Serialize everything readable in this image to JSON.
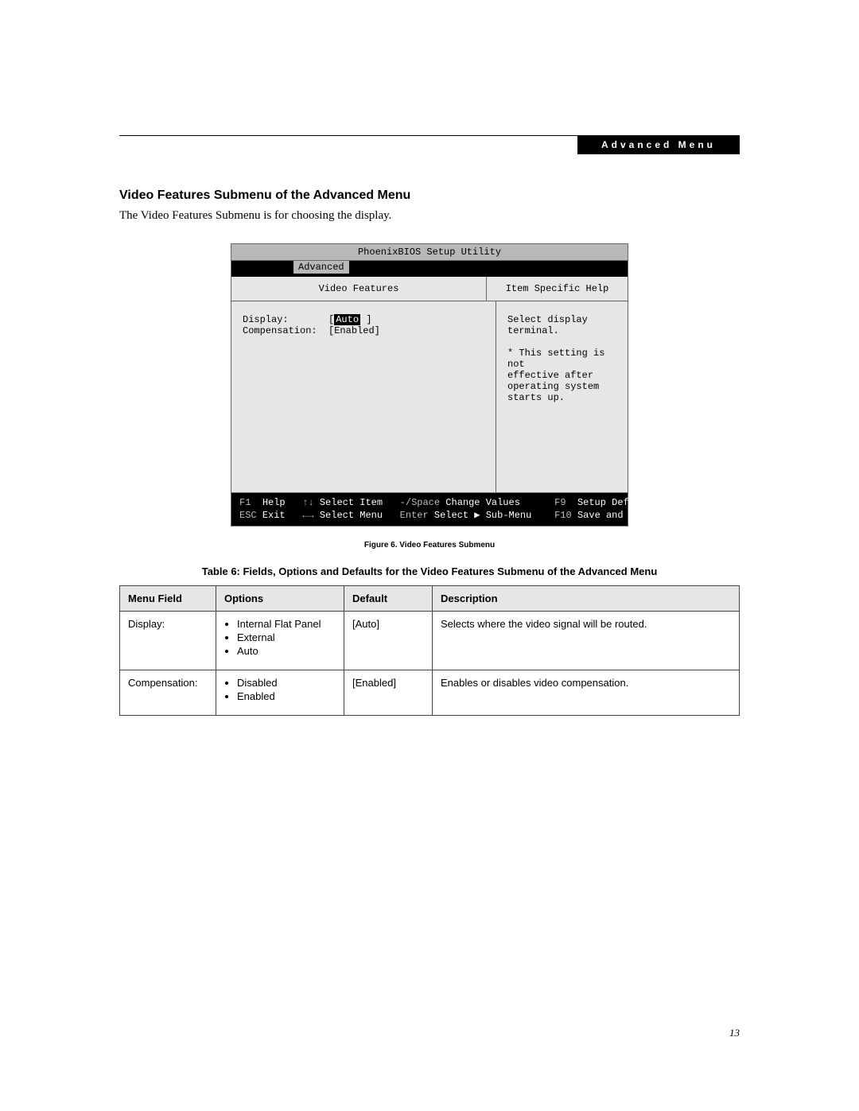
{
  "header": {
    "tab_label": "Advanced Menu"
  },
  "section": {
    "title": "Video Features Submenu of the Advanced Menu",
    "intro": "The Video Features Submenu is for choosing the display."
  },
  "bios": {
    "title": "PhoenixBIOS Setup Utility",
    "active_tab": "Advanced",
    "left_header": "Video Features",
    "right_header": "Item Specific Help",
    "fields": {
      "display_label": "Display:",
      "display_value": "Auto",
      "comp_label": "Compensation:",
      "comp_value": "[Enabled]"
    },
    "help_text": "Select display terminal.\n\n* This setting is not\neffective after\noperating system\nstarts up.",
    "footer": {
      "f1": "F1",
      "f1_label": "Help",
      "ud": "↑↓",
      "ud_label": "Select Item",
      "msp": "-/Space",
      "msp_label": "Change Values",
      "f9": "F9",
      "f9_label": "Setup Defaults",
      "esc": "ESC",
      "esc_label": "Exit",
      "lr": "←→",
      "lr_label": "Select Menu",
      "ent": "Enter",
      "ent_label": "Select ▶ Sub-Menu",
      "f10": "F10",
      "f10_label": "Save and Exit"
    }
  },
  "figure_caption": "Figure 6.  Video Features Submenu",
  "table": {
    "caption": "Table 6: Fields, Options and Defaults for the Video Features Submenu of the Advanced Menu",
    "headers": [
      "Menu Field",
      "Options",
      "Default",
      "Description"
    ],
    "rows": [
      {
        "field": "Display:",
        "options": [
          "Internal Flat Panel",
          "External",
          "Auto"
        ],
        "default": "[Auto]",
        "description": "Selects where the video signal will be routed."
      },
      {
        "field": "Compensation:",
        "options": [
          "Disabled",
          "Enabled"
        ],
        "default": "[Enabled]",
        "description": "Enables or disables video compensation."
      }
    ]
  },
  "page_number": "13"
}
